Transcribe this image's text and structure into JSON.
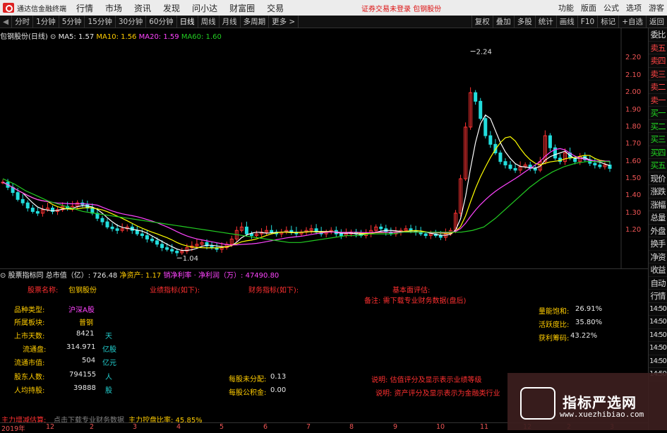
{
  "titlebar": {
    "app_name": "通达信金融终端",
    "menus": [
      "行情",
      "市场",
      "资讯",
      "发现",
      "问小达",
      "财富圈",
      "交易"
    ],
    "center_text": "证券交易未登录   包钢股份",
    "right_items": [
      "功能",
      "版面",
      "公式",
      "选项",
      "游客"
    ]
  },
  "periodbar": {
    "periods": [
      "分时",
      "1分钟",
      "5分钟",
      "15分钟",
      "30分钟",
      "60分钟",
      "日线",
      "周线",
      "月线",
      "多周期",
      "更多 >"
    ],
    "active": "日线",
    "right_buttons": [
      "复权",
      "叠加",
      "多股",
      "统计",
      "画线",
      "F10",
      "标记",
      "+自选",
      "返回"
    ]
  },
  "legend": {
    "stock": "包钢股份(日线)",
    "ma5": "MA5: 1.57",
    "ma10": "MA10: 1.56",
    "ma20": "MA20: 1.59",
    "ma60": "MA60: 1.60"
  },
  "colors": {
    "ma5": "#ffffff",
    "ma10": "#ffff00",
    "ma20": "#ff44ff",
    "ma60": "#22cc22",
    "up": "#ff3333",
    "down": "#22dddd"
  },
  "chart_data": {
    "type": "candlestick",
    "y_ticks": [
      "2.20",
      "2.10",
      "2.00",
      "1.90",
      "1.80",
      "1.70",
      "1.60",
      "1.50",
      "1.40",
      "1.30",
      "1.20"
    ],
    "ylim": [
      1.0,
      2.3
    ],
    "high_label": "2.24",
    "low_label": "1.04",
    "x_ticks": [
      "2019年",
      "12",
      "2",
      "3",
      "4",
      "5",
      "6",
      "7",
      "8",
      "9",
      "10",
      "11",
      "12",
      "2",
      "3"
    ],
    "close_series": [
      1.48,
      1.45,
      1.42,
      1.38,
      1.36,
      1.33,
      1.31,
      1.3,
      1.32,
      1.33,
      1.31,
      1.32,
      1.34,
      1.33,
      1.34,
      1.36,
      1.35,
      1.33,
      1.3,
      1.27,
      1.25,
      1.22,
      1.21,
      1.2,
      1.21,
      1.22,
      1.2,
      1.18,
      1.17,
      1.15,
      1.14,
      1.12,
      1.1,
      1.09,
      1.08,
      1.07,
      1.08,
      1.1,
      1.11,
      1.12,
      1.13,
      1.11,
      1.1,
      1.09,
      1.1,
      1.12,
      1.15,
      1.2,
      1.22,
      1.18,
      1.17,
      1.18,
      1.19,
      1.2,
      1.19,
      1.18,
      1.19,
      1.2,
      1.19,
      1.18,
      1.19,
      1.2,
      1.21,
      1.19,
      1.18,
      1.19,
      1.2,
      1.18,
      1.17,
      1.18,
      1.19,
      1.18,
      1.17,
      1.18,
      1.2,
      1.22,
      1.21,
      1.19,
      1.18,
      1.19,
      1.2,
      1.21,
      1.2,
      1.19,
      1.18,
      1.17,
      1.18,
      1.17,
      1.16,
      1.18,
      1.2,
      1.3,
      1.5,
      1.8,
      2.0,
      1.95,
      1.85,
      1.75,
      1.7,
      1.65,
      1.6,
      1.58,
      1.56,
      1.55,
      1.57,
      1.58,
      1.56,
      1.55,
      1.6,
      1.75,
      1.68,
      1.62,
      1.6,
      1.65,
      1.62,
      1.6,
      1.63,
      1.61,
      1.59,
      1.58,
      1.57,
      1.58,
      1.56
    ],
    "ma60_series": [
      1.5,
      1.47,
      1.43,
      1.4,
      1.37,
      1.35,
      1.33,
      1.31,
      1.3,
      1.29,
      1.28,
      1.27,
      1.26,
      1.25,
      1.24,
      1.23,
      1.22,
      1.21,
      1.2,
      1.19,
      1.18,
      1.17,
      1.16,
      1.15,
      1.14,
      1.13,
      1.13,
      1.14,
      1.15,
      1.16,
      1.17,
      1.17,
      1.18,
      1.18,
      1.18,
      1.19,
      1.19,
      1.19,
      1.19,
      1.19,
      1.19,
      1.2,
      1.22,
      1.27,
      1.33,
      1.39,
      1.45,
      1.5,
      1.54,
      1.57,
      1.59,
      1.6,
      1.6,
      1.6
    ]
  },
  "infobar": {
    "label": "股票指标同",
    "market_cap": "总市值（亿）: 726.48",
    "net_assets": "净资产: 1.17",
    "net_profit": "销净利率 · 净利润（万）: 47490.80"
  },
  "fundamentals": {
    "stock_name_label": "股票名称:",
    "stock_name": "包钢股份",
    "perf_label": "业绩指标(如下):",
    "fin_label": "财务指标(如下):",
    "basic_label": "基本面评估:",
    "remark": "备注: 需下载专业财务数据(盘后)",
    "rows": [
      {
        "label": "品种类型:",
        "value": "沪深A股",
        "unit": ""
      },
      {
        "label": "所属板块:",
        "value": "普钢",
        "unit": ""
      },
      {
        "label": "上市天数:",
        "value": "8421",
        "unit": "天"
      },
      {
        "label": "流通盘:",
        "value": "314.971",
        "unit": "亿股"
      },
      {
        "label": "流通市值:",
        "value": "504",
        "unit": "亿元"
      },
      {
        "label": "股东人数:",
        "value": "794155",
        "unit": "人"
      },
      {
        "label": "人均持股:",
        "value": "39888",
        "unit": "股"
      }
    ],
    "undistributed_label": "每股未分配:",
    "undistributed": "0.13",
    "reserve_label": "每股公积金:",
    "reserve": "0.00",
    "saturation_label": "量能饱和:",
    "saturation": "26.91%",
    "activity_label": "活跃度比:",
    "activity": "35.80%",
    "profit_label": "获利筹码:",
    "profit": "43.22%",
    "note1": "说明: 估值评分及显示表示业绩等级",
    "note2": "说明: 资产评分及显示表示为金融类行业"
  },
  "bottombar": {
    "main_flow": "主力增减估算:",
    "extra": "点击下载专业财务数据",
    "main_control": "主力控盘比率: 45.85%"
  },
  "rightpanel": {
    "items": [
      "委比",
      "卖五",
      "卖四",
      "卖三",
      "卖二",
      "卖一",
      "买一",
      "买二",
      "买三",
      "买四",
      "买五",
      "现价",
      "涨跌",
      "涨幅",
      "总量",
      "外盘",
      "换手",
      "净资",
      "收益",
      "自动",
      "行情",
      "14:50",
      "14:50",
      "14:50",
      "14:50",
      "14:50",
      "14:50"
    ]
  },
  "watermark": {
    "title": "指标严选网",
    "url": "www.xuezhibiao.com"
  }
}
